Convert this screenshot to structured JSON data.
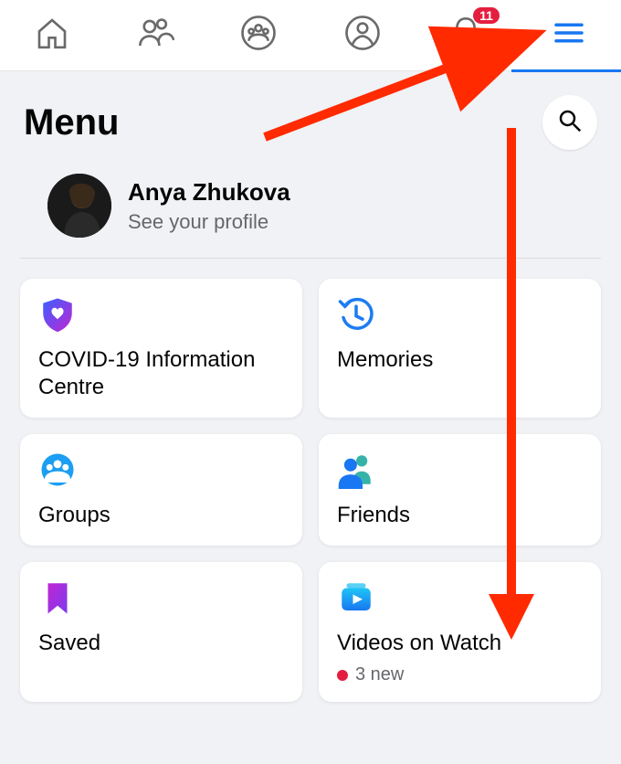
{
  "nav": {
    "notifications_badge": "11"
  },
  "menu": {
    "title": "Menu"
  },
  "profile": {
    "name": "Anya Zhukova",
    "subtitle": "See your profile"
  },
  "cards": {
    "covid": {
      "label": "COVID-19 Information Centre"
    },
    "memories": {
      "label": "Memories"
    },
    "groups": {
      "label": "Groups"
    },
    "friends": {
      "label": "Friends"
    },
    "saved": {
      "label": "Saved"
    },
    "videos": {
      "label": "Videos on Watch",
      "sub": "3 new"
    }
  }
}
